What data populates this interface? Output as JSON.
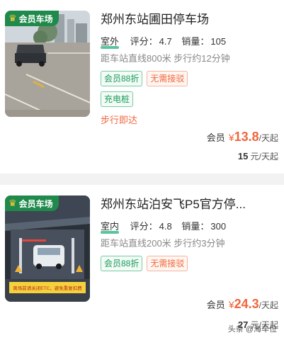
{
  "lots": [
    {
      "badge": "会员车场",
      "title": "郑州东站圃田停车场",
      "place": "室外",
      "rating_label": "评分：",
      "rating": "4.7",
      "sales_label": "销量：",
      "sales": "105",
      "distance": "距车站直线800米 步行约12分钟",
      "tags": [
        "会员88折",
        "无需接驳"
      ],
      "extra_tag": "充电桩",
      "walk_note": "步行即达",
      "member_label": "会员",
      "currency": "¥",
      "member_price": "13.8",
      "unit": "/天起",
      "orig_price": "15",
      "orig_unit": "元/天起"
    },
    {
      "badge": "会员车场",
      "title": "郑州东站泊安飞P5官方停...",
      "place": "室内",
      "rating_label": "评分：",
      "rating": "4.8",
      "sales_label": "销量：",
      "sales": "300",
      "distance": "距车站直线200米 步行约3分钟",
      "tags": [
        "会员88折",
        "无需接驳"
      ],
      "member_label": "会员",
      "currency": "¥",
      "member_price": "24.3",
      "unit": "/天起",
      "orig_price": "27",
      "orig_unit": "元/天起",
      "photo_banner": "离场前请关闭ETC，避免重复扣费"
    }
  ],
  "watermark": "头条 @海车位",
  "colors": {
    "accent": "#f0663c",
    "green": "#1c9a5c",
    "badge": "#1f8a4c"
  }
}
